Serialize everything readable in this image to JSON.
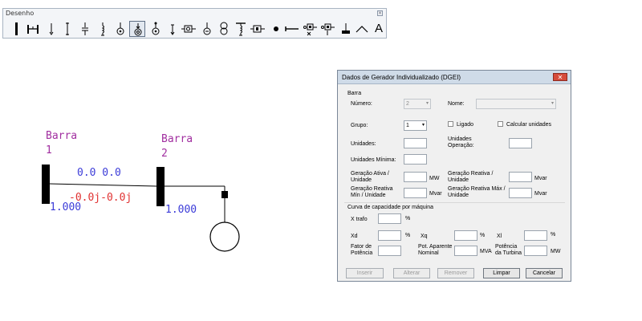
{
  "toolbar": {
    "title": "Desenho",
    "tools": [
      {
        "icon": "bus-bar-icon"
      },
      {
        "icon": "line-icon"
      },
      {
        "icon": "load-arrow-icon"
      },
      {
        "icon": "shunt-icon"
      },
      {
        "icon": "capacitor-icon"
      },
      {
        "icon": "reactor-icon"
      },
      {
        "icon": "generator-icon"
      },
      {
        "icon": "individual-generator-icon",
        "selected": true
      },
      {
        "icon": "motor-icon"
      },
      {
        "icon": "arrow-load-icon"
      },
      {
        "icon": "static-compensator-icon"
      },
      {
        "icon": "synchronous-compensator-icon"
      },
      {
        "icon": "two-winding-transformer-icon"
      },
      {
        "icon": "three-winding-transformer-icon"
      },
      {
        "icon": "series-device-icon"
      },
      {
        "icon": "node-icon"
      },
      {
        "icon": "series-capacitor-icon"
      },
      {
        "icon": "converter-icon"
      },
      {
        "icon": "converter-alt-icon"
      },
      {
        "icon": "ground-icon"
      },
      {
        "icon": "annotation-icon"
      },
      {
        "icon": "text-icon",
        "glyph": "A"
      }
    ]
  },
  "diagram": {
    "bus1": {
      "name_line1": "Barra",
      "name_line2": "1",
      "voltage": "1.000"
    },
    "bus2": {
      "name_line1": "Barra",
      "name_line2": "2",
      "voltage": "1.000"
    },
    "flow_from": "0.0  0.0",
    "flow_to": "-0.0j-0.0j"
  },
  "dialog": {
    "title": "Dados de Gerador Individualizado (DGEI)",
    "section_barra": "Barra",
    "numero_label": "Número:",
    "numero_value": "2",
    "nome_label": "Nome:",
    "nome_value": "",
    "grupo_label": "Grupo:",
    "grupo_value": "1",
    "ligado_label": "Ligado",
    "calcular_label": "Calcular unidades",
    "unidades_label": "Unidades:",
    "unidades_op_label_1": "Unidades",
    "unidades_op_label_2": "Operação:",
    "unidades_min_label": "Unidades Mínima:",
    "ger_ativa_label_1": "Geração Ativa /",
    "ger_ativa_label_2": "Unidade",
    "ger_ativa_unit": "MW",
    "ger_reativa_label_1": "Geração Reativa /",
    "ger_reativa_label_2": "Unidade",
    "ger_reativa_unit": "Mvar",
    "ger_reativa_min_label_1": "Geração Reativa",
    "ger_reativa_min_label_2": "Mín / Unidade",
    "ger_reativa_min_unit": "Mvar",
    "ger_reativa_max_label_1": "Geração Reativa Máx /",
    "ger_reativa_max_label_2": "Unidade",
    "ger_reativa_max_unit": "Mvar",
    "section_curva": "Curva de capacidade por máquina",
    "xtrafo_label": "X trafo",
    "xtrafo_unit": "%",
    "xd_label": "Xd",
    "xd_unit": "%",
    "xq_label": "Xq",
    "xq_unit": "%",
    "xl_label": "Xl",
    "xl_unit": "%",
    "fp_label_1": "Fator de",
    "fp_label_2": "Potência",
    "pot_ap_label_1": "Pot. Aparente",
    "pot_ap_label_2": "Nominal",
    "pot_ap_unit": "MVA",
    "pot_turb_label_1": "Potência",
    "pot_turb_label_2": "da Turbina",
    "pot_turb_unit": "MW",
    "btn_inserir": "Inserir",
    "btn_alterar": "Alterar",
    "btn_remover": "Remover",
    "btn_limpar": "Limpar",
    "btn_cancelar": "Cancelar"
  }
}
